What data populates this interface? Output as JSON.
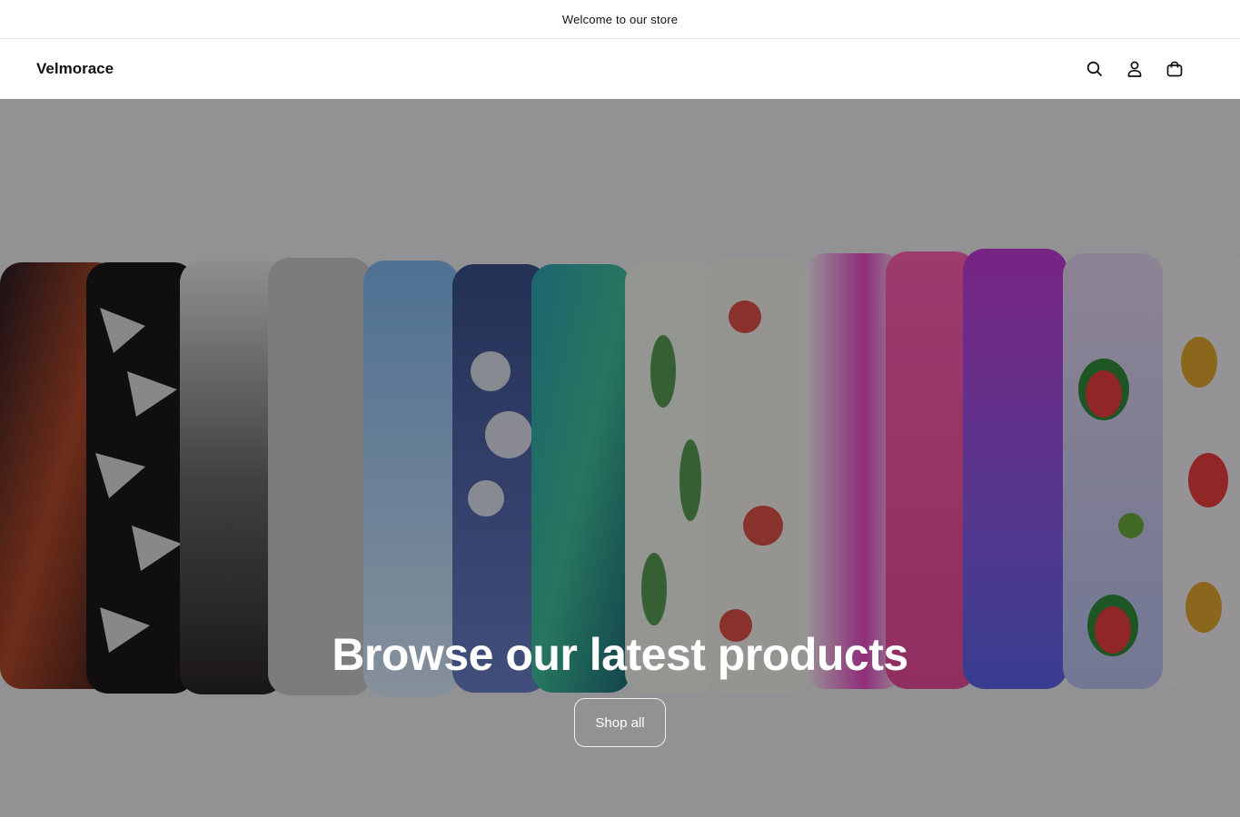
{
  "announcement": {
    "text": "Welcome to our store"
  },
  "header": {
    "logo": "Velmorace",
    "icons": [
      "search-icon",
      "account-icon",
      "cart-icon"
    ]
  },
  "hero": {
    "title": "Browse our latest products",
    "button_label": "Shop all",
    "overlay_opacity": 0.38
  },
  "colors": {
    "text": "#121212",
    "border": "#e3e3e3",
    "hero_text": "#ffffff"
  }
}
